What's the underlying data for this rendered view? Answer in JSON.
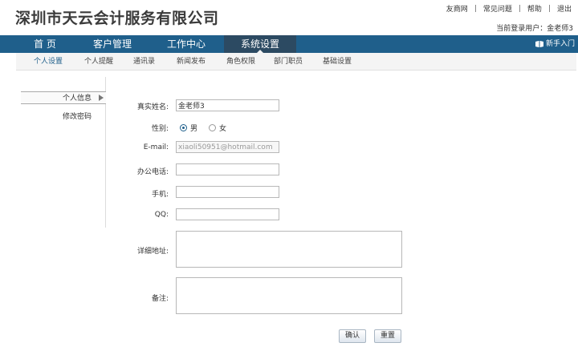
{
  "header": {
    "brand": "深圳市天云会计服务有限公司",
    "links": [
      "友商网",
      "常见问题",
      "帮助",
      "退出"
    ],
    "separator": "|",
    "current_user_label": "当前登录用户：金老师3"
  },
  "mainnav": {
    "items": [
      "首 页",
      "客户管理",
      "工作中心",
      "系统设置"
    ],
    "active_index": 3,
    "guide_label": "新手入门",
    "colors": {
      "bar": "#1f5f8b",
      "active": "#2c4a62"
    }
  },
  "subnav": {
    "items": [
      "个人设置",
      "个人提醒",
      "通讯录",
      "新闻发布",
      "角色权限",
      "部门职员",
      "基础设置"
    ],
    "active_index": 0
  },
  "sidebar": {
    "items": [
      "个人信息",
      "修改密码"
    ],
    "active_index": 0
  },
  "form": {
    "name_label": "真实姓名:",
    "name_value": "金老师3",
    "gender_label": "性别:",
    "gender_options": [
      "男",
      "女"
    ],
    "gender_selected": "男",
    "email_label": "E-mail:",
    "email_value": "xiaoli50951@hotmail.com",
    "office_phone_label": "办公电话:",
    "office_phone_value": "",
    "mobile_label": "手机:",
    "mobile_value": "",
    "qq_label": "QQ:",
    "qq_value": "",
    "address_label": "详细地址:",
    "address_value": "",
    "remark_label": "备注:",
    "remark_value": "",
    "confirm_label": "确认",
    "reset_label": "重置"
  }
}
